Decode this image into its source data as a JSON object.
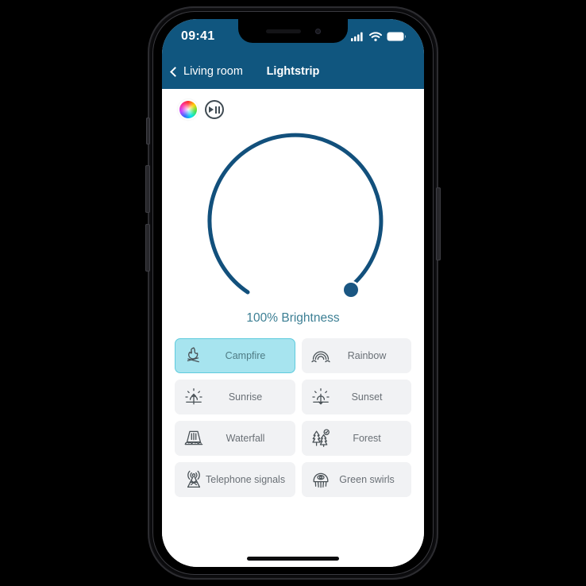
{
  "device": {
    "name": "iphone-mockup",
    "frame_color": "#0b0b0d",
    "buttons": [
      "mute-switch",
      "volume-up",
      "volume-down",
      "power"
    ]
  },
  "status_bar": {
    "time": "09:41",
    "icons": [
      "cellular-signal-icon",
      "wifi-icon",
      "battery-icon"
    ],
    "background": "#10567f"
  },
  "navbar": {
    "back_label": "Living room",
    "back_icon": "chevron-left-icon",
    "title": "Lightstrip",
    "background": "#10567f"
  },
  "top_controls": [
    {
      "name": "color-wheel-button",
      "icon": "color-wheel-icon"
    },
    {
      "name": "play-pause-button",
      "icon": "play-pause-icon"
    }
  ],
  "brightness": {
    "value": 100,
    "label": "100% Brightness",
    "track_color": "#12507c",
    "knob_color": "#1a5682",
    "text_color": "#3c7f94"
  },
  "scenes": {
    "selected": "Campfire",
    "items": [
      {
        "label": "Campfire",
        "icon": "campfire-icon",
        "selected": true
      },
      {
        "label": "Rainbow",
        "icon": "rainbow-icon",
        "selected": false
      },
      {
        "label": "Sunrise",
        "icon": "sunrise-icon",
        "selected": false
      },
      {
        "label": "Sunset",
        "icon": "sunset-icon",
        "selected": false
      },
      {
        "label": "Waterfall",
        "icon": "waterfall-icon",
        "selected": false
      },
      {
        "label": "Forest",
        "icon": "forest-icon",
        "selected": false
      },
      {
        "label": "Telephone signals",
        "icon": "antenna-icon",
        "selected": false
      },
      {
        "label": "Green swirls",
        "icon": "jellyfish-icon",
        "selected": false
      }
    ],
    "tile_color": "#f1f2f4",
    "selected_tile_color": "#a7e4ef",
    "selected_border_color": "#5fcbdd"
  },
  "home_indicator": {
    "name": "home-indicator"
  }
}
